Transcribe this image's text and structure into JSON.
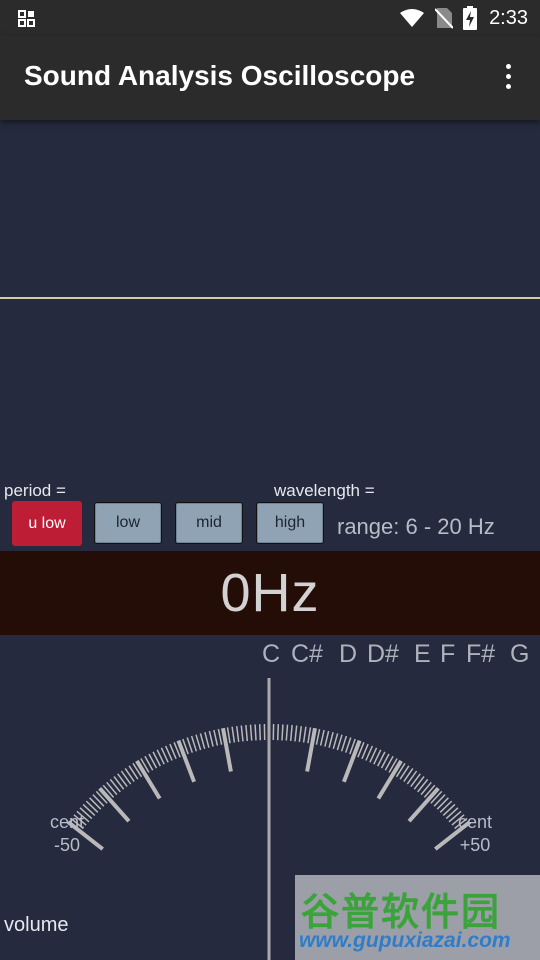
{
  "status_bar": {
    "time": "2:33"
  },
  "app_bar": {
    "title": "Sound Analysis Oscilloscope"
  },
  "labels": {
    "period": "period =",
    "wavelength": "wavelength ="
  },
  "range_buttons": [
    {
      "label": "u low",
      "active": true
    },
    {
      "label": "low",
      "active": false
    },
    {
      "label": "mid",
      "active": false
    },
    {
      "label": "high",
      "active": false
    }
  ],
  "range_text": "range: 6 - 20 Hz",
  "frequency_display": "0Hz",
  "notes": [
    "C",
    "C#",
    "D",
    "D#",
    "E",
    "F",
    "F#",
    "G"
  ],
  "gauge": {
    "left_label": "cent",
    "left_value": "-50",
    "right_label": "cent",
    "right_value": "+50"
  },
  "volume_label": "volume",
  "watermark": {
    "brand": "谷普软件园",
    "url": "www.gupuxiazai.com"
  },
  "colors": {
    "background": "#252a3e",
    "bar": "#2b2b2b",
    "trace": "#d8c8a6",
    "active_button": "#bd1e36",
    "button": "#8fa3b5",
    "frequency_band": "#240c07"
  }
}
